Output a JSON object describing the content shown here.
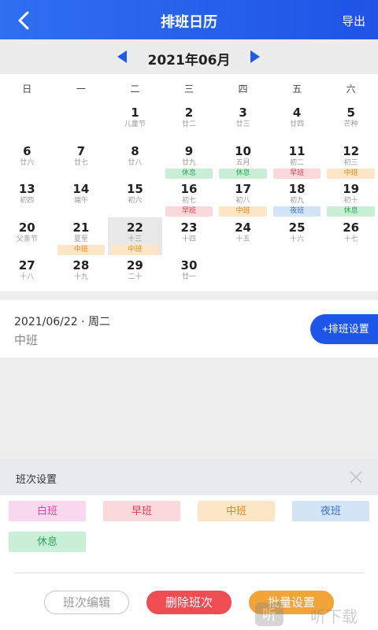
{
  "header": {
    "title": "排班日历",
    "export_label": "导出"
  },
  "calendar": {
    "month_label": "2021年06月",
    "weekdays": [
      "日",
      "一",
      "二",
      "三",
      "四",
      "五",
      "六"
    ],
    "days": [
      {
        "num": "",
        "lunar": ""
      },
      {
        "num": "",
        "lunar": ""
      },
      {
        "num": "1",
        "lunar": "儿童节"
      },
      {
        "num": "2",
        "lunar": "廿二"
      },
      {
        "num": "3",
        "lunar": "廿三"
      },
      {
        "num": "4",
        "lunar": "廿四"
      },
      {
        "num": "5",
        "lunar": "芒种"
      },
      {
        "num": "6",
        "lunar": "廿六"
      },
      {
        "num": "7",
        "lunar": "廿七"
      },
      {
        "num": "8",
        "lunar": "廿八"
      },
      {
        "num": "9",
        "lunar": "廿九",
        "shift": "休息"
      },
      {
        "num": "10",
        "lunar": "五月",
        "shift": "休息"
      },
      {
        "num": "11",
        "lunar": "初二",
        "shift": "早班"
      },
      {
        "num": "12",
        "lunar": "初三",
        "shift": "中班"
      },
      {
        "num": "13",
        "lunar": "初四"
      },
      {
        "num": "14",
        "lunar": "端午"
      },
      {
        "num": "15",
        "lunar": "初六"
      },
      {
        "num": "16",
        "lunar": "初七",
        "shift": "早班"
      },
      {
        "num": "17",
        "lunar": "初八",
        "shift": "中班"
      },
      {
        "num": "18",
        "lunar": "初九",
        "shift": "夜班"
      },
      {
        "num": "19",
        "lunar": "初十",
        "shift": "休息"
      },
      {
        "num": "20",
        "lunar": "父亲节"
      },
      {
        "num": "21",
        "lunar": "夏至",
        "shift": "中班"
      },
      {
        "num": "22",
        "lunar": "十三",
        "shift": "中班",
        "selected": true
      },
      {
        "num": "23",
        "lunar": "十四"
      },
      {
        "num": "24",
        "lunar": "十五"
      },
      {
        "num": "25",
        "lunar": "十六"
      },
      {
        "num": "26",
        "lunar": "十七"
      },
      {
        "num": "27",
        "lunar": "十八"
      },
      {
        "num": "28",
        "lunar": "十九"
      },
      {
        "num": "29",
        "lunar": "二十"
      },
      {
        "num": "30",
        "lunar": "廿一"
      }
    ]
  },
  "shift_styles": {
    "休息": {
      "bg": "#c9f0d7",
      "fg": "#2ea55a"
    },
    "早班": {
      "bg": "#f9d9dc",
      "fg": "#d9434f"
    },
    "中班": {
      "bg": "#fde6c6",
      "fg": "#e0891a"
    },
    "夜班": {
      "bg": "#d3e4f6",
      "fg": "#3b74c4"
    },
    "白班": {
      "bg": "#f8d8ee",
      "fg": "#d04aa3"
    }
  },
  "selected_info": {
    "date": "2021/06/22 · 周二",
    "shift": "中班",
    "set_button": "+排班设置"
  },
  "panel": {
    "title": "班次设置",
    "shifts": [
      "白班",
      "早班",
      "中班",
      "夜班",
      "休息"
    ],
    "edit_button": "班次编辑",
    "delete_button": "删除班次",
    "batch_button": "批量设置"
  },
  "watermark": {
    "text": "听下载"
  }
}
